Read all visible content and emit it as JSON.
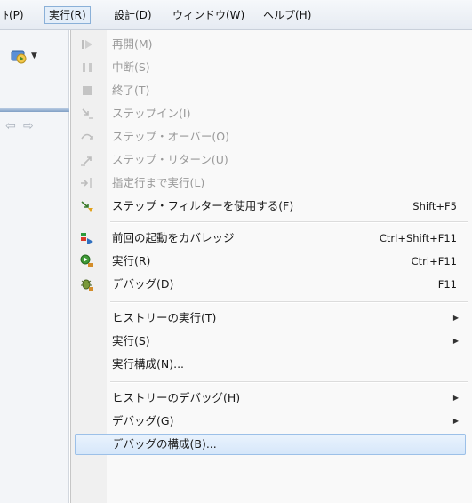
{
  "menubar": {
    "items": [
      {
        "label": "ﾄ(P)"
      },
      {
        "label": "実行(R)"
      },
      {
        "label": "設計(D)"
      },
      {
        "label": "ウィンドウ(W)"
      },
      {
        "label": "ヘルプ(H)"
      }
    ]
  },
  "toolbar": {
    "run_button_icon": "run-config-icon",
    "nav_icons": [
      "back-arrow-icon",
      "forward-arrow-icon"
    ]
  },
  "menu": {
    "items": [
      {
        "label": "再開(M)",
        "shortcut": "",
        "enabled": false,
        "icon": "resume-icon"
      },
      {
        "label": "中断(S)",
        "shortcut": "",
        "enabled": false,
        "icon": "suspend-icon"
      },
      {
        "label": "終了(T)",
        "shortcut": "",
        "enabled": false,
        "icon": "terminate-icon"
      },
      {
        "label": "ステップイン(I)",
        "shortcut": "",
        "enabled": false,
        "icon": "step-into-icon"
      },
      {
        "label": "ステップ・オーバー(O)",
        "shortcut": "",
        "enabled": false,
        "icon": "step-over-icon"
      },
      {
        "label": "ステップ・リターン(U)",
        "shortcut": "",
        "enabled": false,
        "icon": "step-return-icon"
      },
      {
        "label": "指定行まで実行(L)",
        "shortcut": "",
        "enabled": false,
        "icon": "run-to-line-icon"
      },
      {
        "label": "ステップ・フィルターを使用する(F)",
        "shortcut": "Shift+F5",
        "enabled": true,
        "icon": "step-filter-icon"
      },
      {
        "label": "前回の起動をカバレッジ",
        "shortcut": "Ctrl+Shift+F11",
        "enabled": true,
        "icon": "coverage-icon"
      },
      {
        "label": "実行(R)",
        "shortcut": "Ctrl+F11",
        "enabled": true,
        "icon": "run-icon"
      },
      {
        "label": "デバッグ(D)",
        "shortcut": "F11",
        "enabled": true,
        "icon": "debug-icon"
      },
      {
        "label": "ヒストリーの実行(T)",
        "shortcut": "",
        "enabled": true,
        "submenu": true
      },
      {
        "label": "実行(S)",
        "shortcut": "",
        "enabled": true,
        "submenu": true
      },
      {
        "label": "実行構成(N)...",
        "shortcut": "",
        "enabled": true
      },
      {
        "label": "ヒストリーのデバッグ(H)",
        "shortcut": "",
        "enabled": true,
        "submenu": true
      },
      {
        "label": "デバッグ(G)",
        "shortcut": "",
        "enabled": true,
        "submenu": true
      },
      {
        "label": "デバッグの構成(B)...",
        "shortcut": "",
        "enabled": true,
        "highlighted": true
      }
    ]
  }
}
